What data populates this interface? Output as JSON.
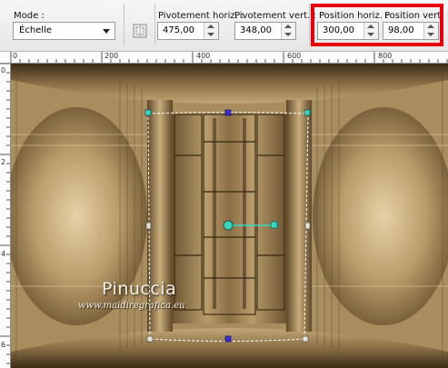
{
  "toolbar": {
    "mode": {
      "label": "Mode :",
      "value": "Échelle"
    },
    "pivot_h": {
      "label": "Pivotement horiz. :",
      "value": "475,00"
    },
    "pivot_v": {
      "label": "Pivotement vert. :",
      "value": "348,00"
    },
    "pos_h": {
      "label": "Position horiz. :",
      "value": "300,00"
    },
    "pos_v": {
      "label": "Position vert. :",
      "value": "98,00"
    }
  },
  "ruler": {
    "top_ticks": [
      "0",
      "200",
      "400",
      "600",
      "800"
    ],
    "left_ticks": [
      "0",
      "2",
      "4",
      "6"
    ]
  },
  "watermark": {
    "name": "Pinuccia",
    "url": "www.maidiregrafica.eu"
  },
  "colors": {
    "highlight": "#e8000d",
    "handle_corner": "#3ad6c0",
    "handle_mid": "#3a2fc8",
    "image_tone": "#b59a6f"
  }
}
